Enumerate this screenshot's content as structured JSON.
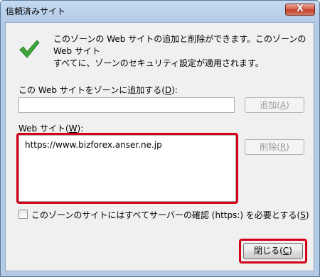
{
  "window": {
    "title": "信頼済みサイト",
    "close_glyph": "X"
  },
  "info": {
    "icon": "green-checkmark",
    "line1": "このゾーンの Web サイトの追加と削除ができます。このゾーンの Web サイト",
    "line2": "すべてに、ゾーンのセキュリティ設定が適用されます。"
  },
  "add_section": {
    "label_prefix": "この Web サイトをゾーンに追加する(",
    "label_key": "D",
    "label_suffix": "):",
    "input_value": "",
    "add_button": {
      "prefix": "追加(",
      "key": "A",
      "suffix": ")"
    }
  },
  "sites_section": {
    "label_prefix": "Web サイト(",
    "label_key": "W",
    "label_suffix": "):",
    "items": [
      "https://www.bizforex.anser.ne.jp"
    ],
    "remove_button": {
      "prefix": "削除(",
      "key": "R",
      "suffix": ")"
    }
  },
  "https_check": {
    "checked": false,
    "label_prefix": "このゾーンのサイトにはすべてサーバーの確認 (https:) を必要とする(",
    "label_key": "S",
    "label_suffix": ")"
  },
  "footer": {
    "close_button": {
      "prefix": "閉じる(",
      "key": "C",
      "suffix": ")"
    }
  },
  "colors": {
    "highlight": "#d4001a",
    "check": "#3fa83a"
  }
}
